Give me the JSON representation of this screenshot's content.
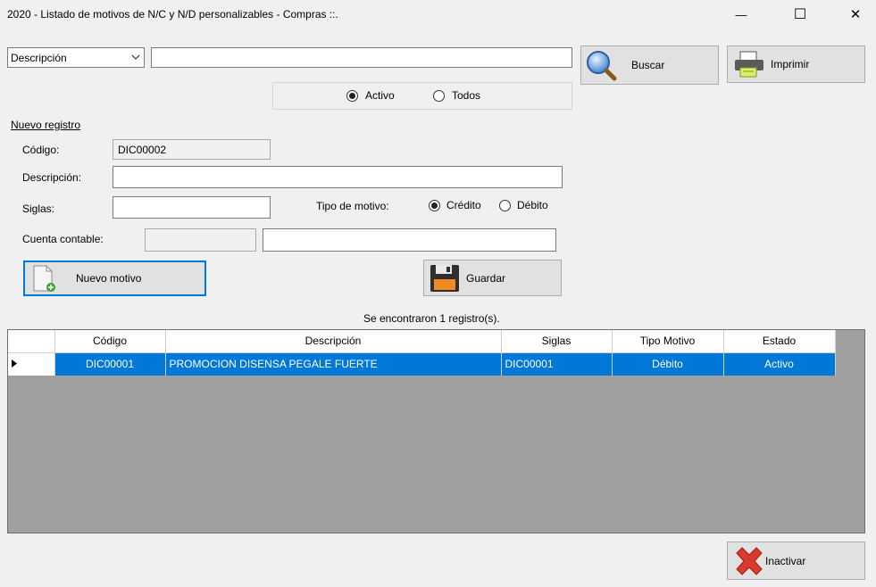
{
  "window": {
    "title": "2020 - Listado de motivos de N/C y N/D personalizables - Compras ::.",
    "minimize_glyph": "—",
    "maximize_glyph": "☐",
    "close_glyph": "✕"
  },
  "search": {
    "field_selected": "Descripción",
    "query_value": "",
    "search_label": "Buscar",
    "print_label": "Imprimir",
    "filter_options": [
      {
        "label": "Activo",
        "checked": true
      },
      {
        "label": "Todos",
        "checked": false
      }
    ]
  },
  "form": {
    "section_title": "Nuevo registro",
    "codigo_label": "Código:",
    "codigo_value": "DIC00002",
    "descripcion_label": "Descripción:",
    "descripcion_value": "",
    "siglas_label": "Siglas:",
    "siglas_value": "",
    "tipo_label": "Tipo de motivo:",
    "tipo_options": [
      {
        "label": "Crédito",
        "checked": true
      },
      {
        "label": "Débito",
        "checked": false
      }
    ],
    "cuenta_label": "Cuenta contable:",
    "cuenta_code_value": "",
    "cuenta_name_value": "",
    "new_button_label": "Nuevo motivo",
    "save_button_label": "Guardar"
  },
  "results": {
    "count_text": "Se encontraron 1 registro(s).",
    "columns": [
      "Código",
      "Descripción",
      "Siglas",
      "Tipo Motivo",
      "Estado"
    ],
    "rows": [
      {
        "codigo": "DIC00001",
        "descripcion": "PROMOCION DISENSA PEGALE FUERTE",
        "siglas": "DIC00001",
        "tipo": "Débito",
        "estado": "Activo",
        "selected": true
      }
    ]
  },
  "footer": {
    "deactivate_label": "Inactivar"
  },
  "colors": {
    "accent": "#0078d7",
    "window_bg": "#f0f0f0",
    "grid_bg": "#a0a0a0"
  }
}
